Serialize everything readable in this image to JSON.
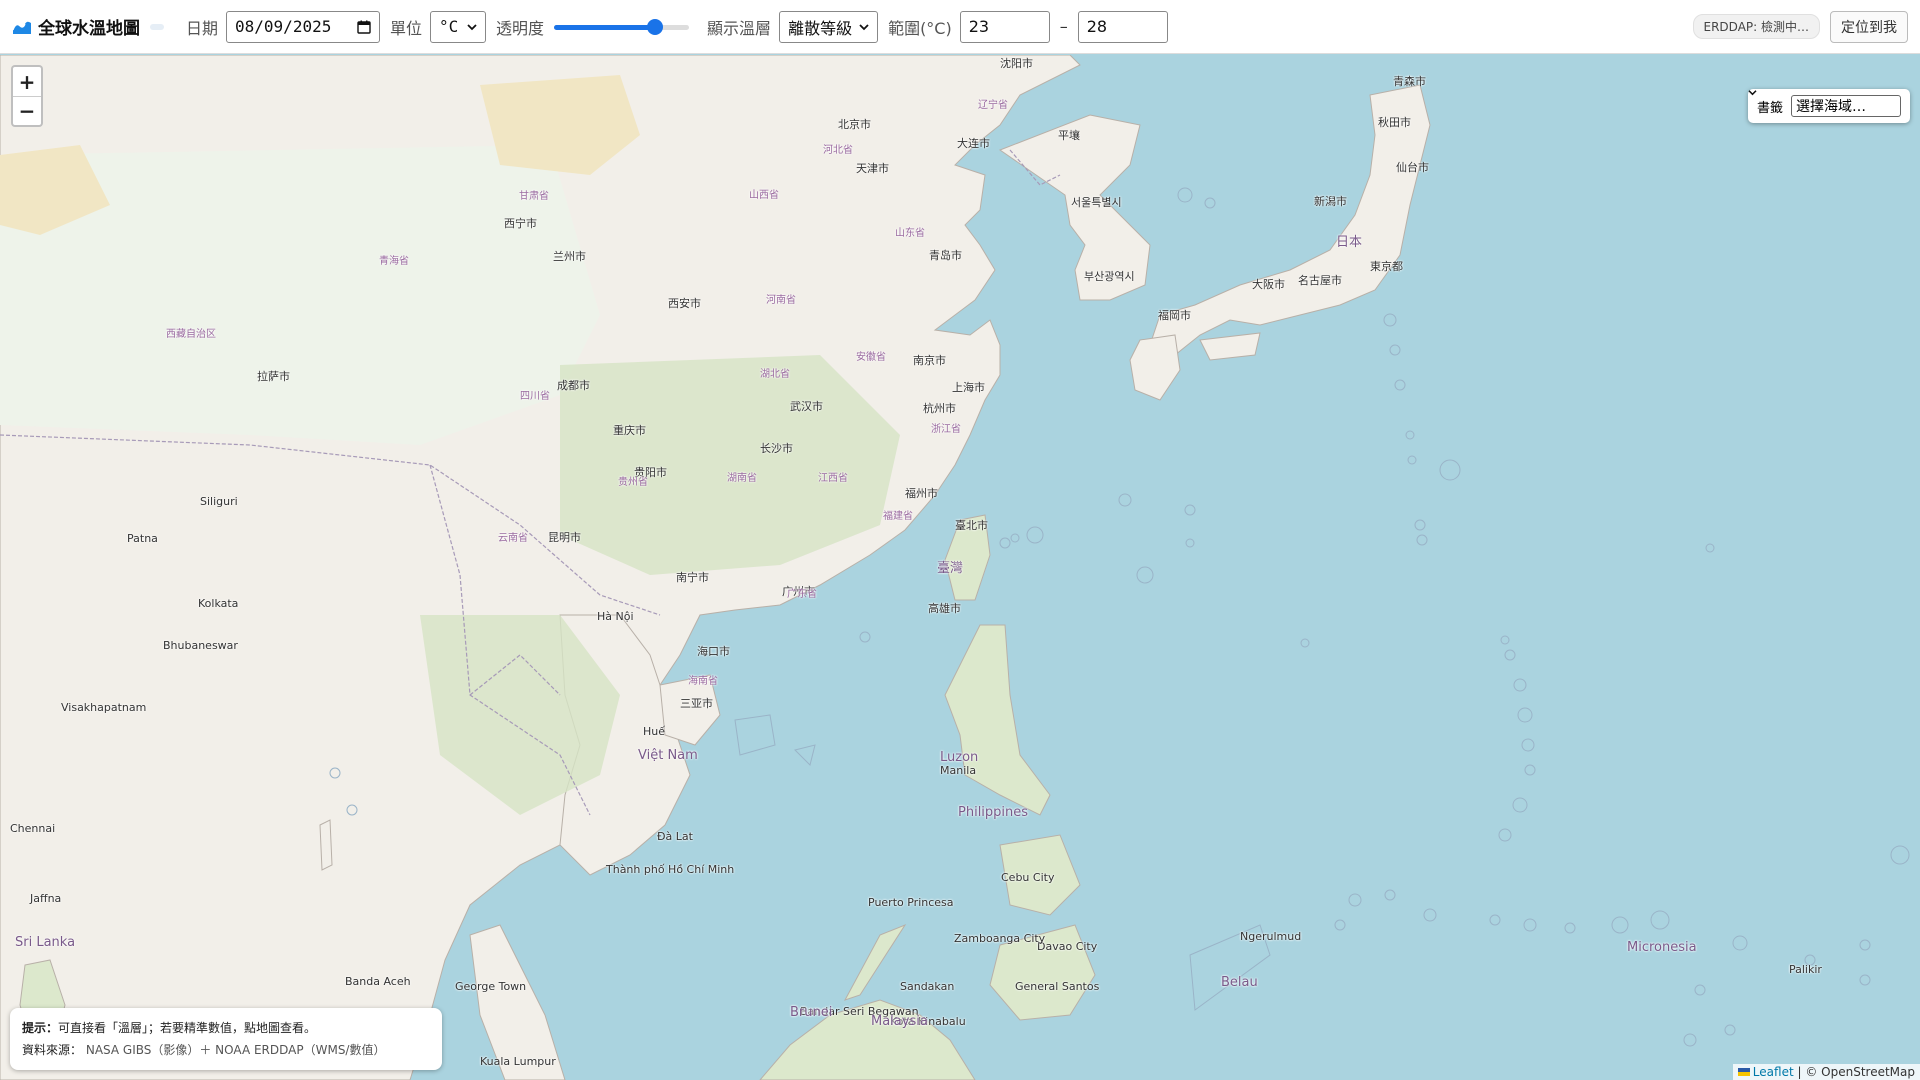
{
  "header": {
    "title": "全球水溫地圖",
    "date_label": "日期",
    "date_value": "08/09/2025",
    "unit_label": "單位",
    "unit_value": "°C",
    "opacity_label": "透明度",
    "opacity_value": 0.78,
    "layer_label": "顯示溫層",
    "layer_value": "離散等級",
    "range_label": "範圍(°C)",
    "range_min": "23",
    "range_sep": "–",
    "range_max": "28",
    "erddap_status": "ERDDAP: 檢測中…",
    "locate_label": "定位到我"
  },
  "map": {
    "zoom_in": "+",
    "zoom_out": "−",
    "bookmark_label": "書籤",
    "bookmark_placeholder": "選擇海域…",
    "hint_title": "提示：",
    "hint_text": "可直接看「溫層」；若要精準數值，點地圖查看。",
    "source_label": "資料來源：",
    "source_text": "NASA GIBS（影像）＋ NOAA ERDDAP（WMS/數值）",
    "attribution_leaflet": "Leaflet",
    "attribution_osm": "| © OpenStreetMap",
    "colors": {
      "sea": "#aad3df",
      "land": "#f2efe9",
      "forest": "#c8dcb4",
      "desert": "#f1e6c4",
      "border": "#a79ab8"
    },
    "labels": {
      "cities": [
        "北京市",
        "天津市",
        "上海市",
        "南京市",
        "杭州市",
        "武汉市",
        "长沙市",
        "重庆市",
        "成都市",
        "西安市",
        "兰州市",
        "西宁市",
        "拉萨市",
        "昆明市",
        "贵阳市",
        "南宁市",
        "广州市",
        "福州市",
        "臺北市",
        "高雄市",
        "海口市",
        "三亚市",
        "青岛市",
        "大连市",
        "沈阳市",
        "平壤",
        "서울특별시",
        "부산광역시",
        "福岡市",
        "大阪市",
        "名古屋市",
        "東京都",
        "新潟市",
        "仙台市",
        "秋田市",
        "青森市",
        "Manila",
        "Hà Nội",
        "Huế",
        "Đà Lat",
        "Thành phố Hồ Chí Minh",
        "Cebu City",
        "Davao City",
        "Zamboanga City",
        "Puerto Princesa",
        "Kolkata",
        "Patna",
        "Siliguri",
        "Chennai",
        "Jaffna",
        "Bhubaneswar",
        "Visakhapatnam",
        "Ngerulmud",
        "Palikir",
        "Kota Kinabalu",
        "Sandakan",
        "General Santos",
        "Bandar Seri Begawan",
        "Kuala Lumpur",
        "George Town",
        "Banda Aceh"
      ],
      "countries": [
        "日本",
        "臺灣",
        "Philippines",
        "Việt Nam",
        "Malaysia",
        "Micronesia",
        "Belau",
        "Brunei",
        "Luzon",
        "Sri Lanka"
      ],
      "seas": [
        "海南省",
        "山西省",
        "河南省",
        "江西省",
        "福建省",
        "安徽省",
        "湖北省",
        "湖南省",
        "浙江省",
        "广东省",
        "四川省",
        "青海省",
        "西藏自治区",
        "云南省",
        "贵州省",
        "甘肃省",
        "辽宁省",
        "山东省",
        "河北省"
      ]
    }
  }
}
